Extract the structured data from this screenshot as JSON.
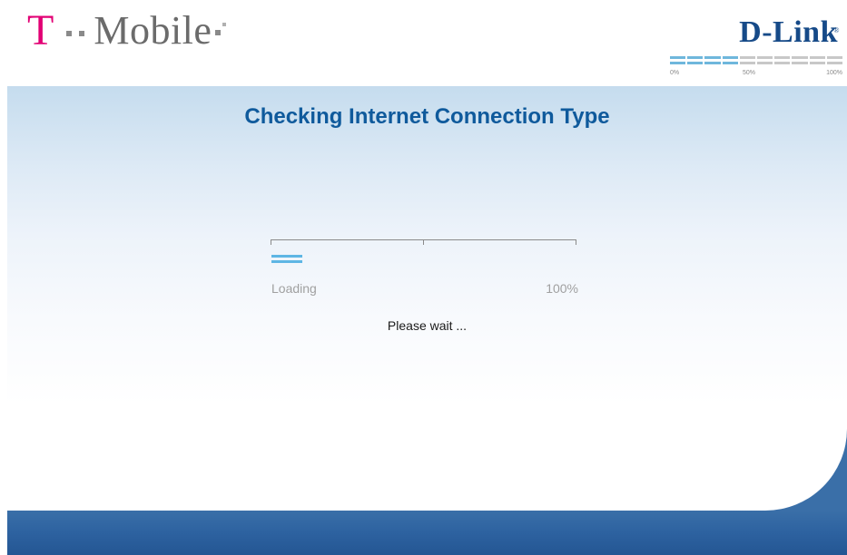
{
  "header": {
    "brand_left": "Mobile",
    "brand_left_initial": "T",
    "brand_right": "D-Link",
    "brand_right_mark": "®",
    "mini_progress": {
      "filled_fraction": 0.4,
      "labels": [
        "0%",
        "50%",
        "100%"
      ]
    }
  },
  "main": {
    "title": "Checking Internet Connection Type",
    "progress": {
      "label": "Loading",
      "percent_text": "100%",
      "fill_fraction": 0.1
    },
    "status_text": "Please wait ..."
  },
  "colors": {
    "tmobile_magenta": "#e20074",
    "dlink_blue": "#164a88",
    "title_blue": "#0f5a9c",
    "progress_cyan": "#5eb6e4",
    "footer_blue": "#2d62a0"
  }
}
